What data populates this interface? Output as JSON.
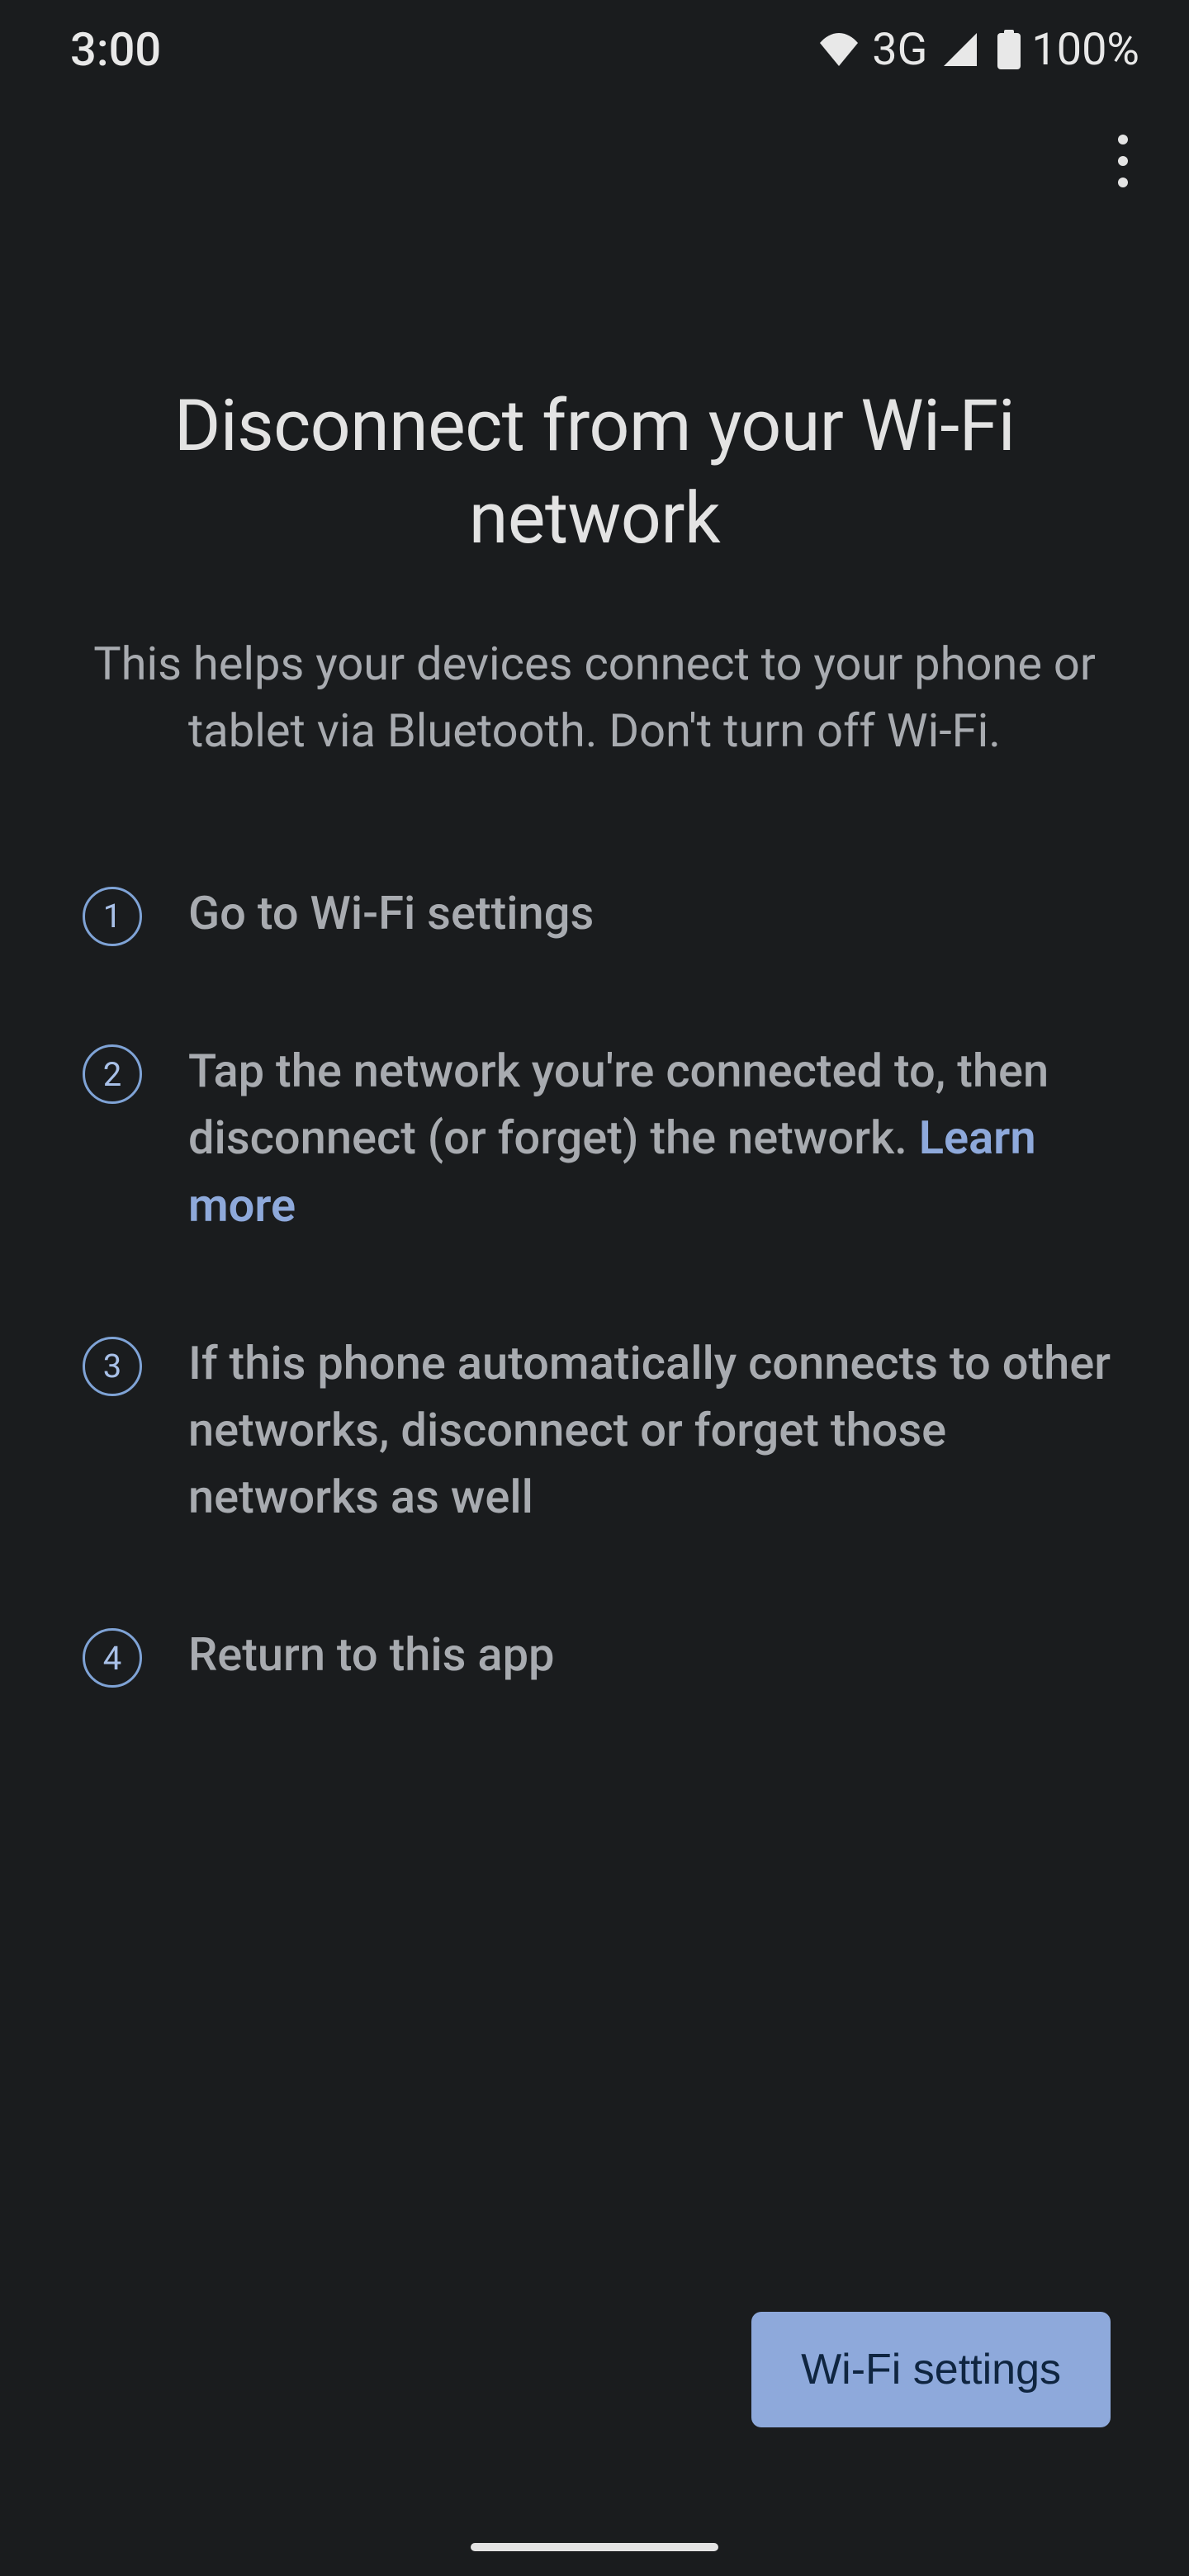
{
  "status_bar": {
    "time": "3:00",
    "network_label": "3G",
    "battery_label": "100%"
  },
  "page": {
    "title": "Disconnect from your Wi-Fi network",
    "subtitle": "This helps your devices connect to your phone or tablet via Bluetooth. Don't turn off Wi-Fi."
  },
  "steps": [
    {
      "number": "1",
      "text": "Go to Wi-Fi settings",
      "link": null
    },
    {
      "number": "2",
      "text": "Tap the network you're connected to, then disconnect (or forget) the network. ",
      "link": "Learn more"
    },
    {
      "number": "3",
      "text": "If this phone automatically connects to other networks, disconnect or forget those networks as well",
      "link": null
    },
    {
      "number": "4",
      "text": "Return to this app",
      "link": null
    }
  ],
  "action": {
    "button_label": "Wi-Fi settings"
  }
}
